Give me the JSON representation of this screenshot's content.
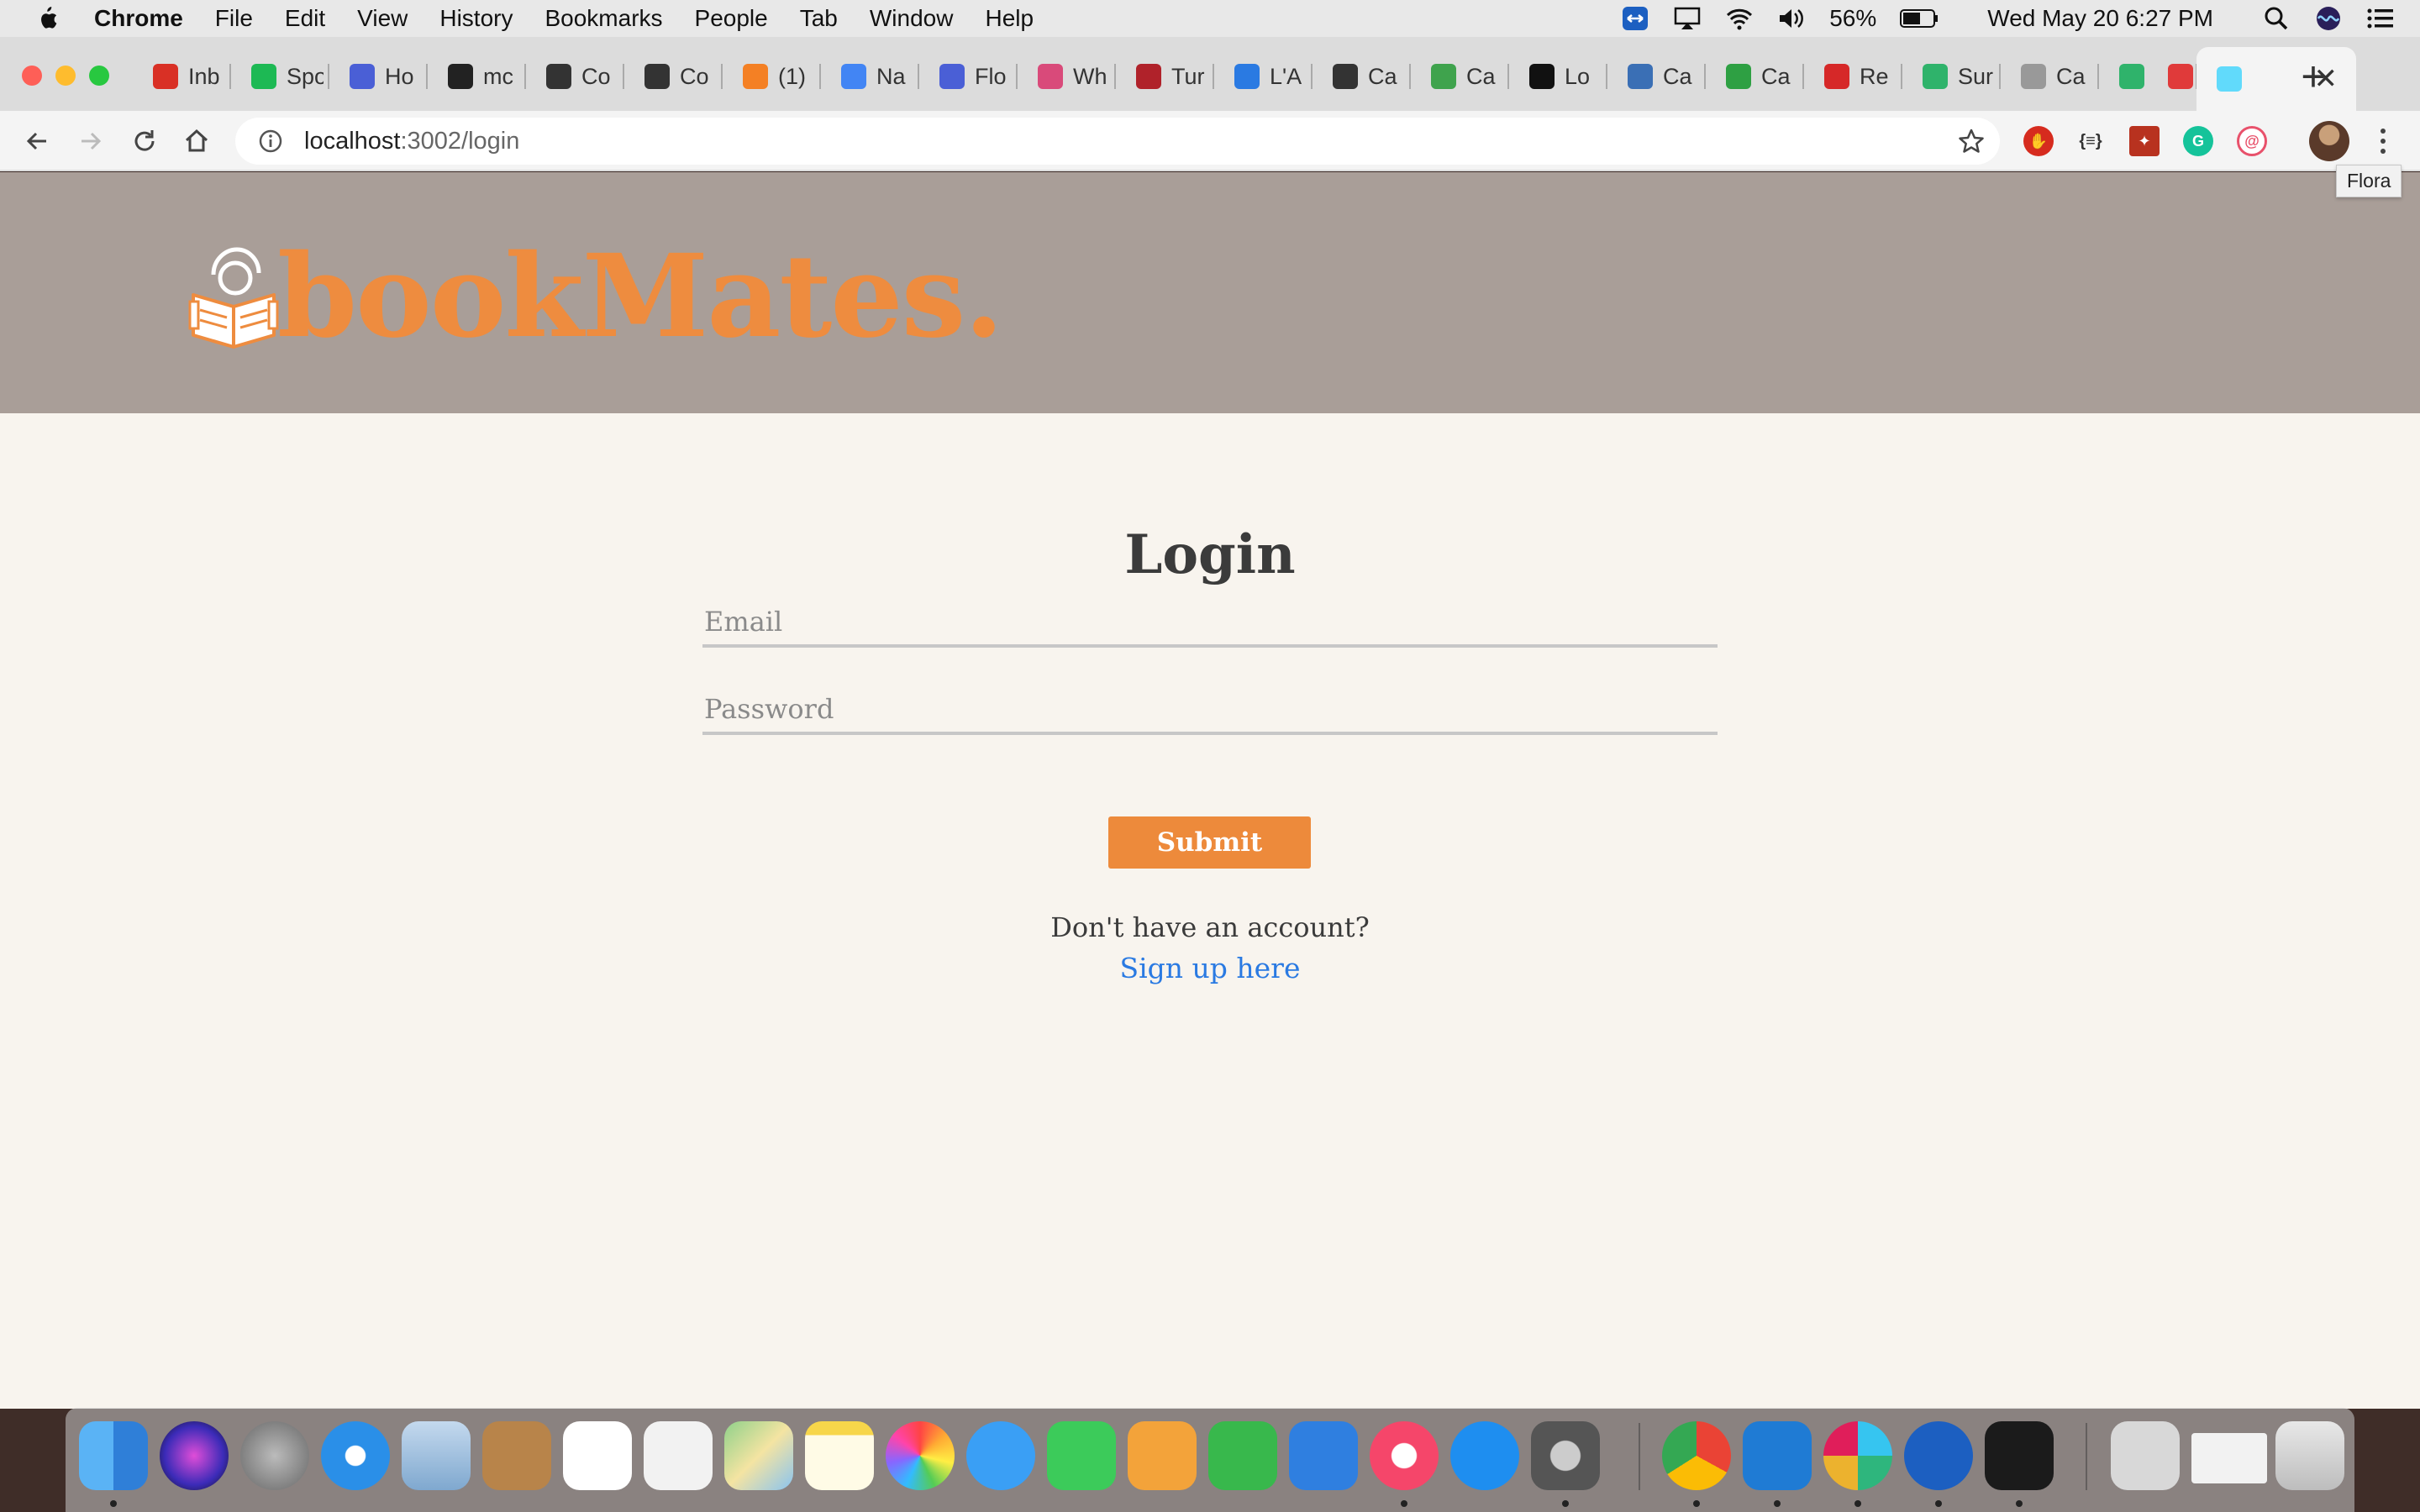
{
  "menubar": {
    "app_name": "Chrome",
    "items": [
      "File",
      "Edit",
      "View",
      "History",
      "Bookmarks",
      "People",
      "Tab",
      "Window",
      "Help"
    ],
    "battery": "56%",
    "clock": "Wed May 20  6:27 PM"
  },
  "tabs": [
    {
      "title": "Inb",
      "icon": "gmail-icon",
      "color": "#d93025"
    },
    {
      "title": "Spo",
      "icon": "spotify-icon",
      "color": "#1db954"
    },
    {
      "title": "Ho",
      "icon": "circle-c-icon",
      "color": "#4a5fd6"
    },
    {
      "title": "mc",
      "icon": "github-icon",
      "color": "#222222"
    },
    {
      "title": "Co",
      "icon": "circle-plus-icon",
      "color": "#333333"
    },
    {
      "title": "Co",
      "icon": "circle-plus-icon",
      "color": "#333333"
    },
    {
      "title": "(1)",
      "icon": "stack-icon",
      "color": "#f48024"
    },
    {
      "title": "Na",
      "icon": "docs-icon",
      "color": "#4285f4"
    },
    {
      "title": "Flo",
      "icon": "circle-c-icon",
      "color": "#4a5fd6"
    },
    {
      "title": "Wh",
      "icon": "slash-icon",
      "color": "#d94a7a"
    },
    {
      "title": "Tur",
      "icon": "magnet-icon",
      "color": "#b0222a"
    },
    {
      "title": "L'A",
      "icon": "diamond-icon",
      "color": "#2a7ae2"
    },
    {
      "title": "Ca",
      "icon": "check-circle-icon",
      "color": "#333333"
    },
    {
      "title": "Ca",
      "icon": "kite-icon",
      "color": "#3fa34d"
    },
    {
      "title": "Lo",
      "icon": "loop-icon",
      "color": "#111111"
    },
    {
      "title": "Ca",
      "icon": "fish-icon",
      "color": "#3a6fb5"
    },
    {
      "title": "Ca",
      "icon": "p-icon",
      "color": "#2ea043"
    },
    {
      "title": "Re",
      "icon": "house-icon",
      "color": "#d62828"
    },
    {
      "title": "Sur",
      "icon": "cloud-icon",
      "color": "#2fb36b"
    },
    {
      "title": "Ca",
      "icon": "dash-icon",
      "color": "#999999"
    },
    {
      "title": "",
      "icon": "chat-icon",
      "color": "#2fb36b"
    },
    {
      "title": "",
      "icon": "record-icon",
      "color": "#e03a3a"
    },
    {
      "title": "",
      "icon": "react-icon",
      "color": "#61dafb",
      "active": true
    }
  ],
  "address": {
    "host": "localhost",
    "path": ":3002/login"
  },
  "profile_tooltip": "Flora",
  "site": {
    "logo_text": "bookMates.",
    "brand_color": "#ee8c3f",
    "header_color": "#a99e98"
  },
  "login": {
    "title": "Login",
    "email_placeholder": "Email",
    "password_placeholder": "Password",
    "submit_label": "Submit",
    "no_account_text": "Don't have an account?",
    "signup_link": "Sign up here"
  }
}
